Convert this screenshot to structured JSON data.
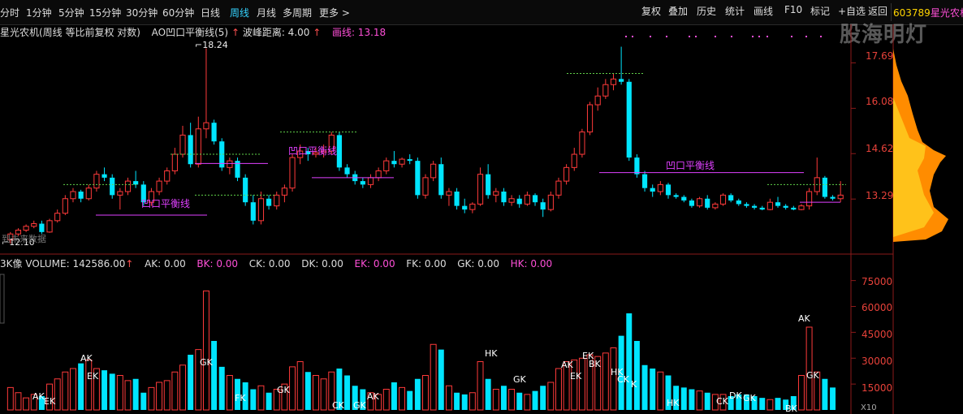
{
  "toolbar": {
    "periods": [
      "分时",
      "1分钟",
      "5分钟",
      "15分钟",
      "30分钟",
      "60分钟",
      "日线",
      "周线",
      "月线",
      "多周期"
    ],
    "active_period": "周线",
    "more": "更多 >",
    "buttons": [
      "复权",
      "叠加",
      "历史",
      "统计",
      "画线",
      "F10",
      "标记",
      "+自选",
      "返回"
    ],
    "stock_code": "603789",
    "stock_name": "星光农机"
  },
  "title_bar": {
    "stock": "星光农机(周线 等比前复权 对数)",
    "indicator": "AO凹口平衡线(5)",
    "wave_label": "波峰距离: 4.00",
    "draw_label": "画线: 13.18",
    "colors": {
      "text": "#dddddd",
      "magenta": "#ff4fd8",
      "arrow": "#ff5050"
    }
  },
  "watermark": "股海明灯",
  "price_axis": {
    "ticks": [
      "17.69",
      "16.08",
      "14.62",
      "13.29"
    ],
    "high_label": "18.24",
    "low_label": "12.10"
  },
  "annotations": {
    "balance_line_label": "凹口平衡线",
    "to_future": "到未来数据"
  },
  "indicator_bar": {
    "name": "3K像",
    "volume": "VOLUME: 142586.00",
    "items": [
      {
        "label": "AK: 0.00",
        "color": "#dddddd"
      },
      {
        "label": "BK: 0.00",
        "color": "#ff4fd8"
      },
      {
        "label": "CK: 0.00",
        "color": "#dddddd"
      },
      {
        "label": "DK: 0.00",
        "color": "#dddddd"
      },
      {
        "label": "EK: 0.00",
        "color": "#ff4fd8"
      },
      {
        "label": "FK: 0.00",
        "color": "#dddddd"
      },
      {
        "label": "GK: 0.00",
        "color": "#dddddd"
      },
      {
        "label": "HK: 0.00",
        "color": "#ff4fd8"
      }
    ]
  },
  "volume_axis": {
    "ticks": [
      "75000",
      "60000",
      "45000",
      "30000",
      "15000"
    ],
    "unit": "X10"
  },
  "signal_labels": [
    "AK",
    "EK",
    "AK",
    "EK",
    "GK",
    "FK",
    "GK",
    "CK",
    "GK",
    "AK",
    "HK",
    "GK",
    "AK",
    "EK",
    "EK",
    "BK",
    "HK",
    "CK",
    "K",
    "HK",
    "CK",
    "DK",
    "GK",
    "AK",
    "BK",
    "GK"
  ],
  "chart_data": {
    "type": "candlestick",
    "candles": [
      [
        12.2,
        12.4,
        12.1,
        12.35
      ],
      [
        12.35,
        12.5,
        12.3,
        12.45
      ],
      [
        12.45,
        12.6,
        12.4,
        12.55
      ],
      [
        12.55,
        12.7,
        12.5,
        12.62
      ],
      [
        12.62,
        12.7,
        12.35,
        12.4
      ],
      [
        12.4,
        12.75,
        12.38,
        12.7
      ],
      [
        12.7,
        13.0,
        12.65,
        12.9
      ],
      [
        12.9,
        13.4,
        12.85,
        13.3
      ],
      [
        13.3,
        13.6,
        13.2,
        13.5
      ],
      [
        13.5,
        13.55,
        13.2,
        13.3
      ],
      [
        13.3,
        13.7,
        13.25,
        13.6
      ],
      [
        13.6,
        14.1,
        13.5,
        14.0
      ],
      [
        14.0,
        14.2,
        13.8,
        13.9
      ],
      [
        13.9,
        14.0,
        13.3,
        13.4
      ],
      [
        13.4,
        13.6,
        13.0,
        13.5
      ],
      [
        13.5,
        13.9,
        13.4,
        13.8
      ],
      [
        13.8,
        14.1,
        13.6,
        13.7
      ],
      [
        13.7,
        13.8,
        13.1,
        13.2
      ],
      [
        13.2,
        13.6,
        13.1,
        13.5
      ],
      [
        13.5,
        13.9,
        13.4,
        13.8
      ],
      [
        13.8,
        14.2,
        13.7,
        14.1
      ],
      [
        14.1,
        14.8,
        14.0,
        14.6
      ],
      [
        14.6,
        15.5,
        14.5,
        15.2
      ],
      [
        15.2,
        15.6,
        14.2,
        14.3
      ],
      [
        14.3,
        15.8,
        14.2,
        15.4
      ],
      [
        15.4,
        18.24,
        15.1,
        15.6
      ],
      [
        15.6,
        15.7,
        14.9,
        15.0
      ],
      [
        15.0,
        15.1,
        14.1,
        14.2
      ],
      [
        14.2,
        14.5,
        14.0,
        14.4
      ],
      [
        14.4,
        14.5,
        13.8,
        13.9
      ],
      [
        13.9,
        14.0,
        13.1,
        13.2
      ],
      [
        13.2,
        13.4,
        12.6,
        12.7
      ],
      [
        12.7,
        13.5,
        12.6,
        13.3
      ],
      [
        13.3,
        13.4,
        13.0,
        13.1
      ],
      [
        13.1,
        13.5,
        13.0,
        13.4
      ],
      [
        13.4,
        13.7,
        13.2,
        13.6
      ],
      [
        13.6,
        14.6,
        13.5,
        14.5
      ],
      [
        14.5,
        14.9,
        14.3,
        14.7
      ],
      [
        14.7,
        14.8,
        14.4,
        14.6
      ],
      [
        14.6,
        14.8,
        14.5,
        14.65
      ],
      [
        14.65,
        14.9,
        14.5,
        14.7
      ],
      [
        14.7,
        15.3,
        14.6,
        15.2
      ],
      [
        15.2,
        15.3,
        14.1,
        14.2
      ],
      [
        14.2,
        14.3,
        13.9,
        14.0
      ],
      [
        14.0,
        14.1,
        13.7,
        13.8
      ],
      [
        13.8,
        13.9,
        13.6,
        13.7
      ],
      [
        13.7,
        14.0,
        13.6,
        13.9
      ],
      [
        13.9,
        14.2,
        13.8,
        14.1
      ],
      [
        14.1,
        14.5,
        14.0,
        14.4
      ],
      [
        14.4,
        14.7,
        14.2,
        14.3
      ],
      [
        14.3,
        14.5,
        14.2,
        14.45
      ],
      [
        14.45,
        14.6,
        14.3,
        14.4
      ],
      [
        14.4,
        14.5,
        13.3,
        13.4
      ],
      [
        13.4,
        14.0,
        13.3,
        13.9
      ],
      [
        13.9,
        14.4,
        13.8,
        14.3
      ],
      [
        14.3,
        14.5,
        13.3,
        13.4
      ],
      [
        13.4,
        13.6,
        13.1,
        13.5
      ],
      [
        13.5,
        13.6,
        13.0,
        13.1
      ],
      [
        13.1,
        13.3,
        12.9,
        13.0
      ],
      [
        13.0,
        13.2,
        12.9,
        13.15
      ],
      [
        13.15,
        14.2,
        13.1,
        14.0
      ],
      [
        14.0,
        14.3,
        13.3,
        13.4
      ],
      [
        13.4,
        13.6,
        13.2,
        13.5
      ],
      [
        13.5,
        13.6,
        13.1,
        13.2
      ],
      [
        13.2,
        13.4,
        13.1,
        13.3
      ],
      [
        13.3,
        13.4,
        13.05,
        13.15
      ],
      [
        13.15,
        13.5,
        13.1,
        13.4
      ],
      [
        13.4,
        13.45,
        13.1,
        13.2
      ],
      [
        13.2,
        13.3,
        12.8,
        13.0
      ],
      [
        13.0,
        13.5,
        12.95,
        13.4
      ],
      [
        13.4,
        13.9,
        13.3,
        13.8
      ],
      [
        13.8,
        14.3,
        13.7,
        14.2
      ],
      [
        14.2,
        14.8,
        14.1,
        14.6
      ],
      [
        14.6,
        15.4,
        14.5,
        15.3
      ],
      [
        15.3,
        16.3,
        15.2,
        16.2
      ],
      [
        16.2,
        16.8,
        16.0,
        16.5
      ],
      [
        16.5,
        17.1,
        16.4,
        16.9
      ],
      [
        16.9,
        17.3,
        16.7,
        17.1
      ],
      [
        17.1,
        18.3,
        16.9,
        17.0
      ],
      [
        17.0,
        17.1,
        14.4,
        14.5
      ],
      [
        14.5,
        14.6,
        13.9,
        14.0
      ],
      [
        14.0,
        14.1,
        13.5,
        13.6
      ],
      [
        13.6,
        13.7,
        13.35,
        13.5
      ],
      [
        13.5,
        13.8,
        13.4,
        13.7
      ],
      [
        13.7,
        13.75,
        13.3,
        13.4
      ],
      [
        13.4,
        13.45,
        13.3,
        13.35
      ],
      [
        13.35,
        13.4,
        13.2,
        13.25
      ],
      [
        13.25,
        13.3,
        13.05,
        13.1
      ],
      [
        13.1,
        13.35,
        13.05,
        13.3
      ],
      [
        13.3,
        13.4,
        13.0,
        13.05
      ],
      [
        13.05,
        13.2,
        13.0,
        13.15
      ],
      [
        13.15,
        13.45,
        13.1,
        13.4
      ],
      [
        13.4,
        13.45,
        13.2,
        13.25
      ],
      [
        13.25,
        13.3,
        13.1,
        13.15
      ],
      [
        13.15,
        13.2,
        13.05,
        13.1
      ],
      [
        13.1,
        13.15,
        13.0,
        13.05
      ],
      [
        13.05,
        13.1,
        12.98,
        13.0
      ],
      [
        13.0,
        13.3,
        12.98,
        13.2
      ],
      [
        13.2,
        13.35,
        13.05,
        13.1
      ],
      [
        13.1,
        13.15,
        13.0,
        13.05
      ],
      [
        13.05,
        13.1,
        12.98,
        13.0
      ],
      [
        13.0,
        13.15,
        12.98,
        13.1
      ],
      [
        13.1,
        13.6,
        13.0,
        13.5
      ],
      [
        13.5,
        14.5,
        13.4,
        13.9
      ],
      [
        13.9,
        13.95,
        13.3,
        13.35
      ],
      [
        13.35,
        13.4,
        13.25,
        13.3
      ],
      [
        13.3,
        13.8,
        13.2,
        13.4
      ]
    ],
    "volumes": [
      13,
      10,
      7,
      9,
      8,
      15,
      18,
      22,
      24,
      27,
      29,
      24,
      23,
      21,
      20,
      17,
      18,
      10,
      13,
      16,
      17,
      22,
      26,
      32,
      35,
      69,
      40,
      25,
      20,
      18,
      16,
      12,
      14,
      10,
      12,
      15,
      25,
      28,
      22,
      20,
      18,
      22,
      24,
      20,
      14,
      12,
      10,
      9,
      12,
      16,
      13,
      11,
      18,
      20,
      38,
      35,
      14,
      10,
      9,
      10,
      28,
      18,
      12,
      14,
      12,
      10,
      9,
      11,
      14,
      16,
      24,
      28,
      29,
      30,
      32,
      31,
      33,
      36,
      43,
      56,
      40,
      26,
      24,
      22,
      20,
      14,
      13,
      12,
      11,
      10,
      9,
      9,
      8,
      9,
      9,
      8,
      7,
      6,
      7,
      6,
      8,
      20,
      48,
      22,
      18,
      13
    ],
    "hollow": [
      false,
      false,
      false,
      false,
      false,
      false,
      false,
      false,
      false,
      false,
      false,
      false,
      false,
      true,
      false,
      false,
      false,
      true,
      false,
      false,
      false,
      false,
      false,
      true,
      false,
      false,
      true,
      true,
      false,
      true,
      true,
      true,
      false,
      true,
      false,
      false,
      false,
      false,
      true,
      false,
      false,
      false,
      true,
      true,
      true,
      true,
      false,
      false,
      false,
      true,
      false,
      true,
      true,
      false,
      false,
      true,
      false,
      true,
      true,
      false,
      false,
      true,
      false,
      true,
      false,
      true,
      false,
      true,
      true,
      false,
      false,
      false,
      false,
      false,
      false,
      false,
      false,
      false,
      false,
      true,
      true,
      true,
      true,
      false,
      true,
      true,
      true,
      true,
      false,
      true,
      false,
      false,
      true,
      true,
      true,
      true,
      true,
      false,
      true,
      true,
      true,
      false,
      false,
      false,
      true,
      true,
      false
    ],
    "price_range": [
      11.9,
      18.6
    ],
    "volume_range": [
      0,
      80000
    ]
  }
}
